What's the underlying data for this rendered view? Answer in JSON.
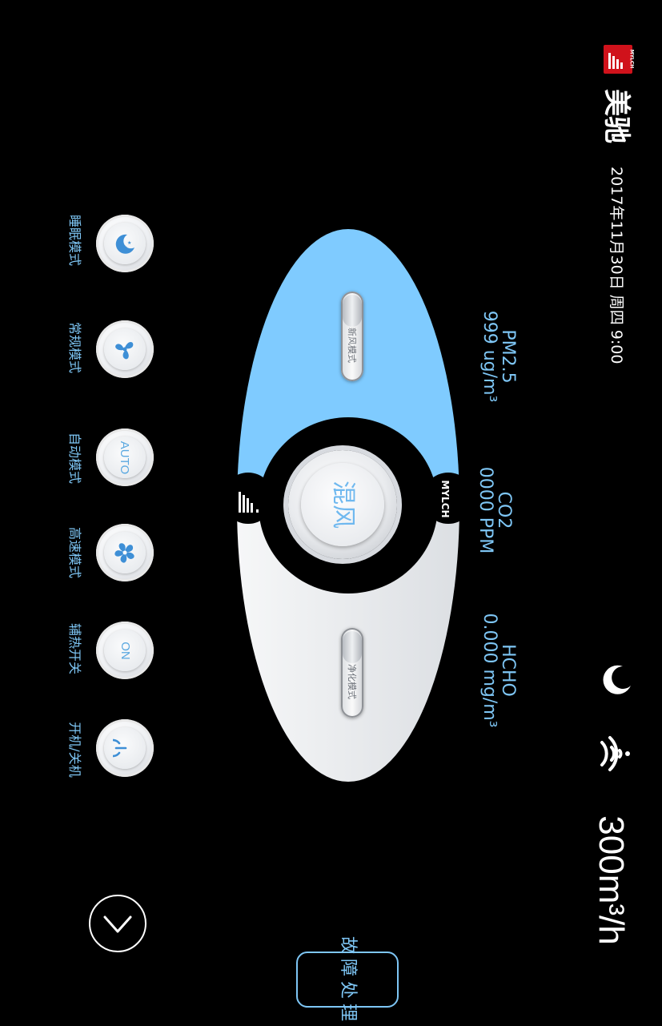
{
  "brand": {
    "name": "美驰",
    "logo_text": "MYLCH"
  },
  "datetime": "2017年11月30日 周四 9:00",
  "airflow": "300m³/h",
  "status_icons": [
    "moon-stars-icon",
    "wifi-icon"
  ],
  "sensors": {
    "pm25": {
      "label": "PM2.5",
      "value": "999 ug/m³"
    },
    "co2": {
      "label": "CO2",
      "value": "0000 PPM"
    },
    "hcho": {
      "label": "HCHO",
      "value": "0.000 mg/m³"
    }
  },
  "controller": {
    "center_label": "混风",
    "brand_tag": "MYLCH",
    "top_toggle": "新风模式",
    "bottom_toggle": "净化模式"
  },
  "modes": [
    {
      "label": "睡眠模式",
      "icon": "moon-stars-icon"
    },
    {
      "label": "常规模式",
      "icon": "fan-icon"
    },
    {
      "label": "自动模式",
      "icon_text": "AUTO"
    },
    {
      "label": "高速模式",
      "icon": "fan-fast-icon"
    },
    {
      "label": "辅热开关",
      "icon_text": "ON"
    },
    {
      "label": "开机/关机",
      "icon": "power-icon"
    }
  ],
  "fault_button": "故障处理",
  "colors": {
    "accent": "#7ec6f5",
    "background": "#000000",
    "top_panel": "#7fcbff",
    "bottom_panel": "#e8eaed"
  }
}
